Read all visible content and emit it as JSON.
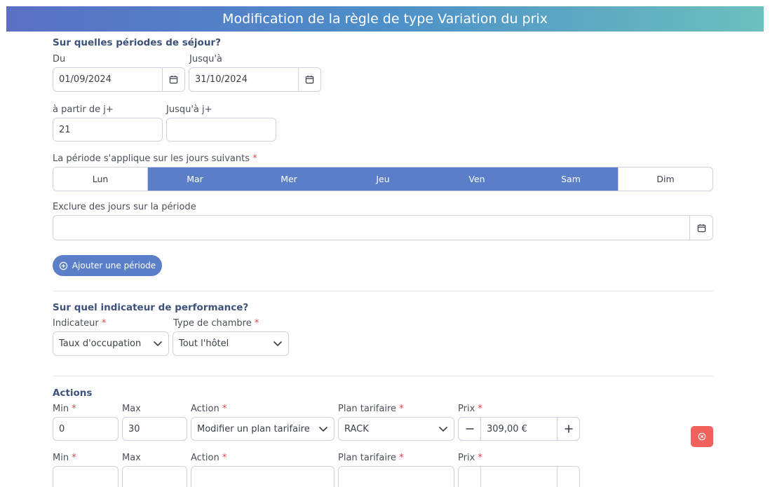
{
  "header": {
    "title": "Modification de la règle de type Variation du prix"
  },
  "periods": {
    "title": "Sur quelles périodes de séjour?",
    "from_label": "Du",
    "from_value": "01/09/2024",
    "to_label": "Jusqu'à",
    "to_value": "31/10/2024",
    "jplus_from_label": "à partir de j+",
    "jplus_from_value": "21",
    "jplus_to_label": "Jusqu'à j+",
    "jplus_to_value": "",
    "days_label": "La période s'applique sur les jours suivants",
    "required_mark": "*",
    "days": [
      {
        "label": "Lun",
        "selected": false
      },
      {
        "label": "Mar",
        "selected": true
      },
      {
        "label": "Mer",
        "selected": true
      },
      {
        "label": "Jeu",
        "selected": true
      },
      {
        "label": "Ven",
        "selected": true
      },
      {
        "label": "Sam",
        "selected": true
      },
      {
        "label": "Dim",
        "selected": false
      }
    ],
    "exclude_label": "Exclure des jours sur la période",
    "exclude_value": "",
    "add_period_label": "Ajouter une période"
  },
  "indicator": {
    "title": "Sur quel indicateur de performance?",
    "indicator_label": "Indicateur",
    "indicator_value": "Taux d'occupation",
    "room_label": "Type de chambre",
    "room_value": "Tout l'hôtel"
  },
  "actions": {
    "title": "Actions",
    "rows": [
      {
        "min_label": "Min",
        "min_value": "0",
        "max_label": "Max",
        "max_value": "30",
        "action_label": "Action",
        "action_value": "Modifier un plan tarifaire",
        "plan_label": "Plan tarifaire",
        "plan_value": "RACK",
        "price_label": "Prix",
        "price_value": "309,00 €"
      },
      {
        "min_label": "Min",
        "min_value": "",
        "max_label": "Max",
        "max_value": "",
        "action_label": "Action",
        "action_value": "",
        "plan_label": "Plan tarifaire",
        "plan_value": "",
        "price_label": "Prix",
        "price_value": ""
      }
    ]
  },
  "colors": {
    "accent": "#5b7ec9",
    "danger": "#f0625b",
    "section_title": "#3d5278"
  }
}
